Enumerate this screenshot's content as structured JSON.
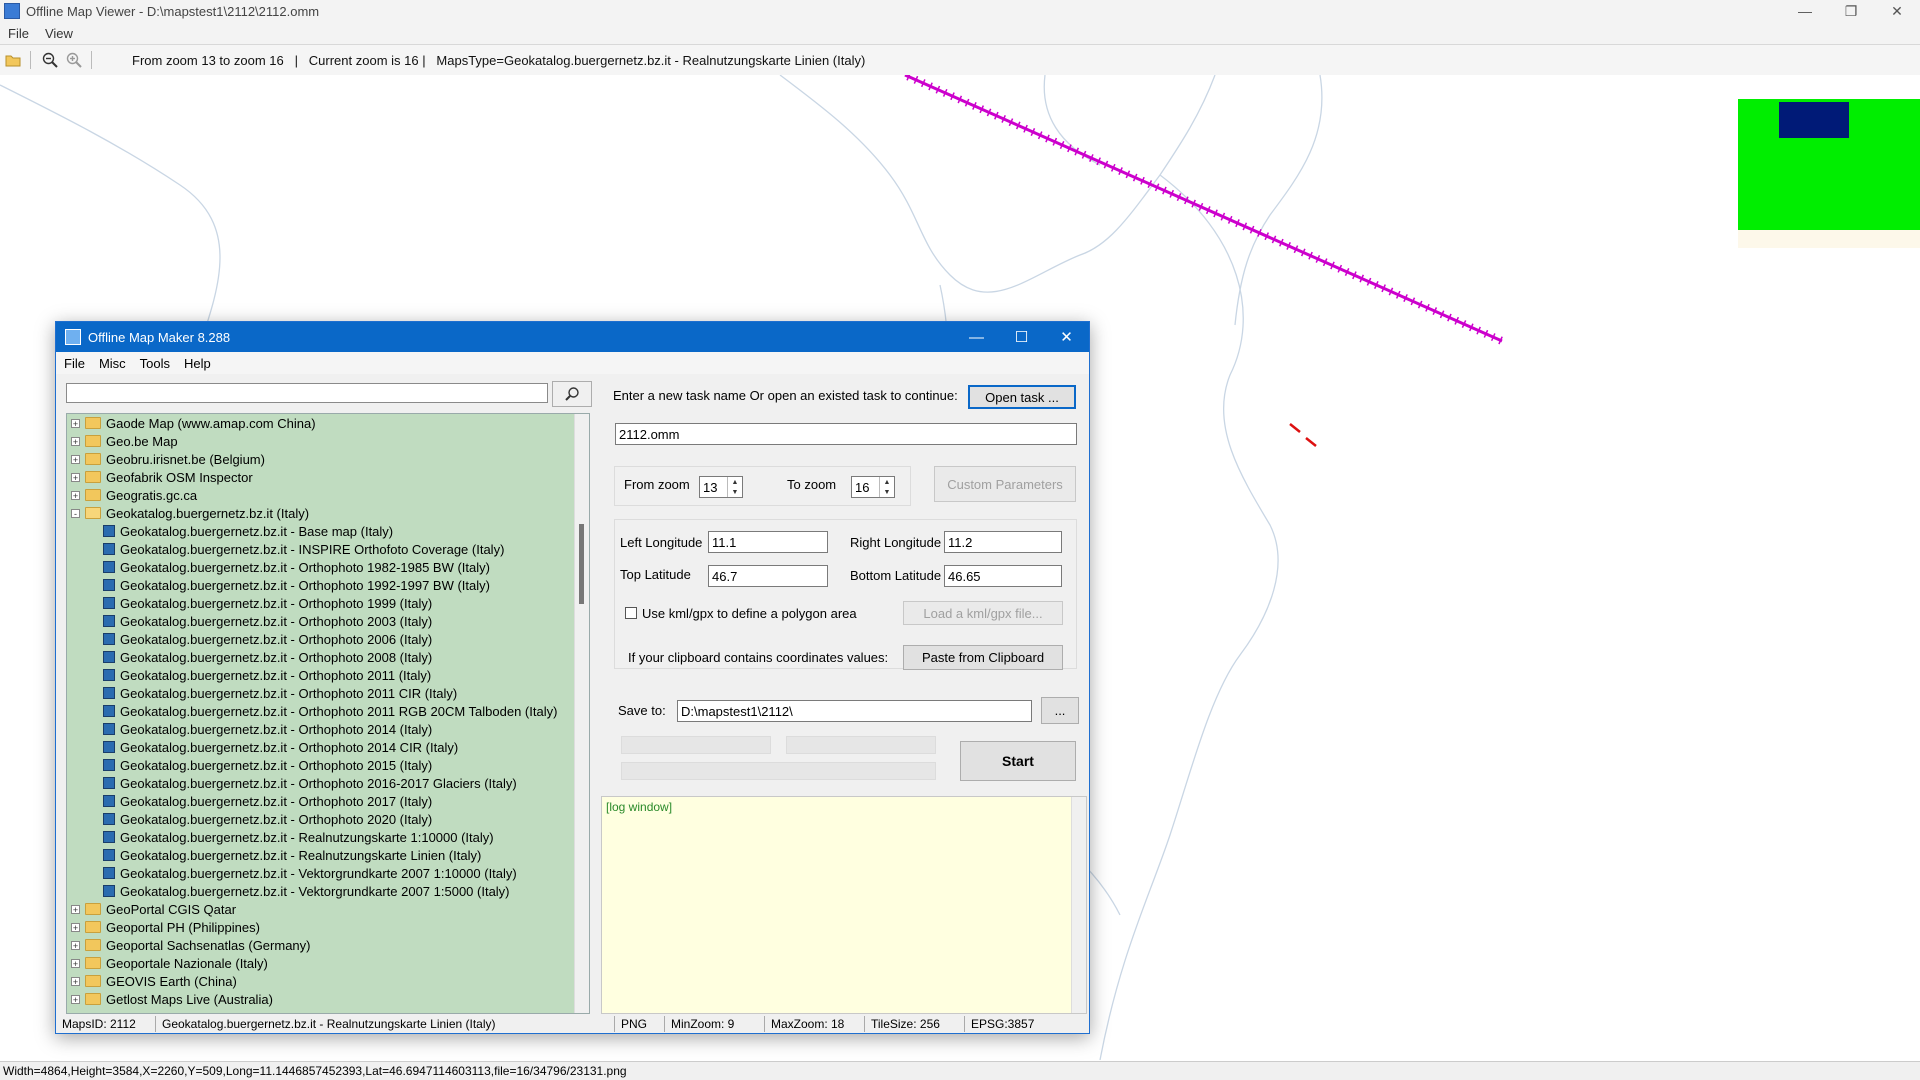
{
  "viewer": {
    "title": "Offline Map Viewer - D:\\mapstest1\\2112\\2112.omm",
    "menu": [
      "File",
      "View"
    ],
    "toolbar_text": "From zoom 13 to zoom 16   |   Current zoom is 16 |   MapsType=Geokatalog.buergernetz.bz.it - Realnutzungskarte Linien (Italy)",
    "status": "Width=4864,Height=3584,X=2260,Y=509,Long=11.1446857452393,Lat=46.6947114603113,file=16/34796/23131.png"
  },
  "colors": {
    "dialog_title_bg": "#0a68c8",
    "tree_bg": "#c0dcc0",
    "log_bg": "#ffffe0",
    "map_line": "#cc00cc",
    "map_red": "#dd1111",
    "map_green": "#00ee00",
    "map_navy": "#001a77"
  },
  "dialog": {
    "title": "Offline Map Maker 8.288",
    "menu": [
      "File",
      "Misc",
      "Tools",
      "Help"
    ],
    "search": {
      "value": "",
      "placeholder": ""
    },
    "tree": [
      {
        "label": "Gaode Map (www.amap.com China)",
        "level": 0,
        "expander": "+"
      },
      {
        "label": "Geo.be Map",
        "level": 0,
        "expander": "+"
      },
      {
        "label": "Geobru.irisnet.be (Belgium)",
        "level": 0,
        "expander": "+"
      },
      {
        "label": "Geofabrik OSM Inspector",
        "level": 0,
        "expander": "+"
      },
      {
        "label": "Geogratis.gc.ca",
        "level": 0,
        "expander": "+"
      },
      {
        "label": "Geokatalog.buergernetz.bz.it (Italy)",
        "level": 0,
        "expander": "-"
      },
      {
        "label": "Geokatalog.buergernetz.bz.it - Base map (Italy)",
        "level": 1
      },
      {
        "label": "Geokatalog.buergernetz.bz.it - INSPIRE Orthofoto Coverage (Italy)",
        "level": 1
      },
      {
        "label": "Geokatalog.buergernetz.bz.it - Orthophoto 1982-1985 BW (Italy)",
        "level": 1
      },
      {
        "label": "Geokatalog.buergernetz.bz.it - Orthophoto 1992-1997 BW (Italy)",
        "level": 1
      },
      {
        "label": "Geokatalog.buergernetz.bz.it - Orthophoto 1999 (Italy)",
        "level": 1
      },
      {
        "label": "Geokatalog.buergernetz.bz.it - Orthophoto 2003 (Italy)",
        "level": 1
      },
      {
        "label": "Geokatalog.buergernetz.bz.it - Orthophoto 2006 (Italy)",
        "level": 1
      },
      {
        "label": "Geokatalog.buergernetz.bz.it - Orthophoto 2008 (Italy)",
        "level": 1
      },
      {
        "label": "Geokatalog.buergernetz.bz.it - Orthophoto 2011 (Italy)",
        "level": 1
      },
      {
        "label": "Geokatalog.buergernetz.bz.it - Orthophoto 2011 CIR (Italy)",
        "level": 1
      },
      {
        "label": "Geokatalog.buergernetz.bz.it - Orthophoto 2011 RGB 20CM Talboden (Italy)",
        "level": 1
      },
      {
        "label": "Geokatalog.buergernetz.bz.it - Orthophoto 2014 (Italy)",
        "level": 1
      },
      {
        "label": "Geokatalog.buergernetz.bz.it - Orthophoto 2014 CIR (Italy)",
        "level": 1
      },
      {
        "label": "Geokatalog.buergernetz.bz.it - Orthophoto 2015 (Italy)",
        "level": 1
      },
      {
        "label": "Geokatalog.buergernetz.bz.it - Orthophoto 2016-2017 Glaciers (Italy)",
        "level": 1
      },
      {
        "label": "Geokatalog.buergernetz.bz.it - Orthophoto 2017 (Italy)",
        "level": 1
      },
      {
        "label": "Geokatalog.buergernetz.bz.it - Orthophoto 2020 (Italy)",
        "level": 1
      },
      {
        "label": "Geokatalog.buergernetz.bz.it - Realnutzungskarte 1:10000 (Italy)",
        "level": 1
      },
      {
        "label": "Geokatalog.buergernetz.bz.it - Realnutzungskarte Linien (Italy)",
        "level": 1
      },
      {
        "label": "Geokatalog.buergernetz.bz.it - Vektorgrundkarte 2007 1:10000 (Italy)",
        "level": 1
      },
      {
        "label": "Geokatalog.buergernetz.bz.it - Vektorgrundkarte 2007 1:5000 (Italy)",
        "level": 1
      },
      {
        "label": "GeoPortal CGIS Qatar",
        "level": 0,
        "expander": "+"
      },
      {
        "label": "Geoportal PH (Philippines)",
        "level": 0,
        "expander": "+"
      },
      {
        "label": "Geoportal Sachsenatlas (Germany)",
        "level": 0,
        "expander": "+"
      },
      {
        "label": "Geoportale Nazionale (Italy)",
        "level": 0,
        "expander": "+"
      },
      {
        "label": "GEOVIS Earth (China)",
        "level": 0,
        "expander": "+"
      },
      {
        "label": "Getlost Maps Live (Australia)",
        "level": 0,
        "expander": "+"
      }
    ],
    "task_prompt": "Enter a new task name Or open an existed task to continue:",
    "open_task_label": "Open task ...",
    "task_name": "2112.omm",
    "from_zoom_label": "From zoom",
    "from_zoom_value": "13",
    "to_zoom_label": "To zoom",
    "to_zoom_value": "16",
    "custom_params_label": "Custom Parameters",
    "left_lon_label": "Left Longitude",
    "left_lon_value": "11.1",
    "right_lon_label": "Right Longitude",
    "right_lon_value": "11.2",
    "top_lat_label": "Top Latitude",
    "top_lat_value": "46.7",
    "bottom_lat_label": "Bottom Latitude",
    "bottom_lat_value": "46.65",
    "kml_checkbox_label": "Use kml/gpx to define a polygon area",
    "load_kml_label": "Load a kml/gpx file...",
    "clipboard_text": "If your clipboard contains coordinates values:",
    "paste_label": "Paste from Clipboard",
    "save_to_label": "Save to:",
    "save_to_value": "D:\\mapstest1\\2112\\",
    "browse_label": "...",
    "start_label": "Start",
    "log_text": "[log window]",
    "status": {
      "maps_id": "MapsID: 2112",
      "maps_name": "Geokatalog.buergernetz.bz.it - Realnutzungskarte Linien (Italy)",
      "format": "PNG",
      "min_zoom": "MinZoom: 9",
      "max_zoom": "MaxZoom: 18",
      "tile_size": "TileSize: 256",
      "epsg": "EPSG:3857"
    }
  }
}
